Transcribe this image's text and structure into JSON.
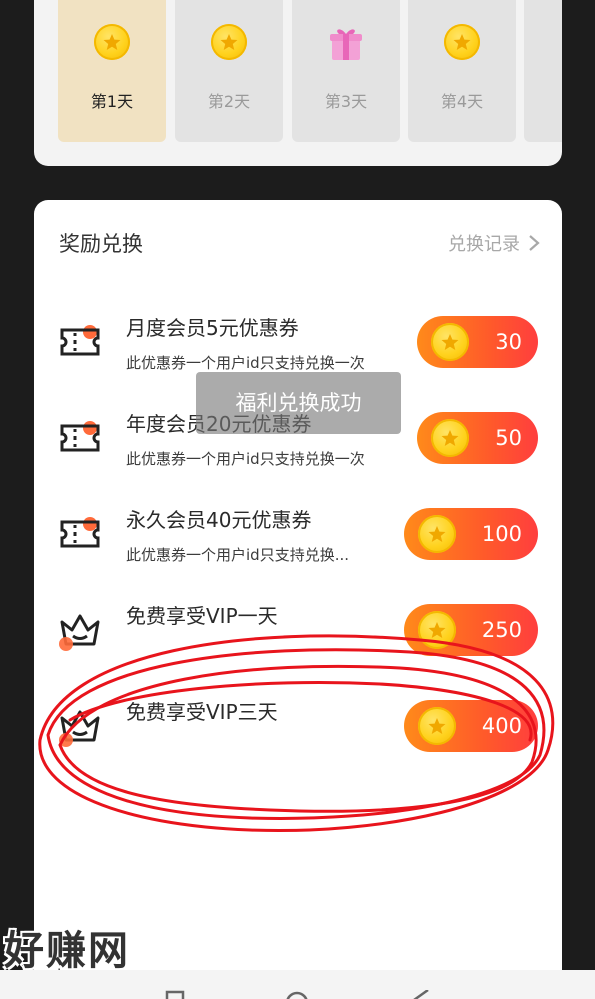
{
  "checkin": {
    "days": [
      {
        "label": "第1天",
        "reward": "coin-icon",
        "active": true
      },
      {
        "label": "第2天",
        "reward": "coin-icon",
        "active": false
      },
      {
        "label": "第3天",
        "reward": "gift-icon",
        "active": false
      },
      {
        "label": "第4天",
        "reward": "coin-icon",
        "active": false
      }
    ]
  },
  "rewards": {
    "title": "奖励兑换",
    "history_label": "兑换记录",
    "items": [
      {
        "title": "月度会员5元优惠券",
        "desc": "此优惠券一个用户id只支持兑换一次",
        "price": "30",
        "icon": "ticket-icon"
      },
      {
        "title": "年度会员20元优惠券",
        "desc": "此优惠券一个用户id只支持兑换一次",
        "price": "50",
        "icon": "ticket-icon"
      },
      {
        "title": "永久会员40元优惠券",
        "desc": "此优惠券一个用户id只支持兑换...",
        "price": "100",
        "icon": "ticket-icon"
      },
      {
        "title": "免费享受VIP一天",
        "desc": "",
        "price": "250",
        "icon": "crown-icon"
      },
      {
        "title": "免费享受VIP三天",
        "desc": "",
        "price": "400",
        "icon": "crown-icon"
      }
    ]
  },
  "toast": {
    "text": "福利兑换成功"
  },
  "watermark": {
    "main": "好赚网",
    "url": "www.zhuanyes.com"
  },
  "colors": {
    "accent": "#ff5a2a",
    "coin": "#ffd21d",
    "annotation": "#e8141c",
    "active_day": "#f1e2c2"
  }
}
